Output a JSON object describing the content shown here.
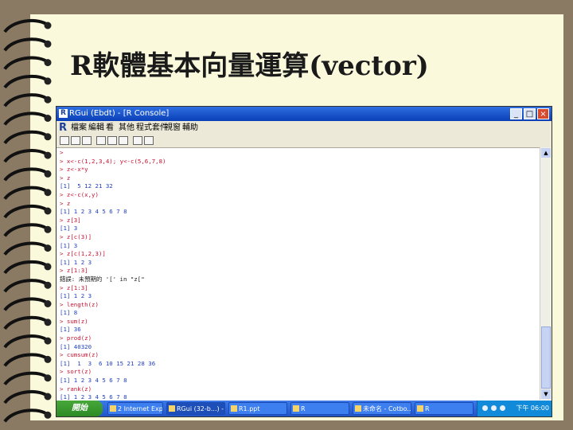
{
  "slide": {
    "title": "R軟體基本向量運算(vector)"
  },
  "window": {
    "title": "RGui (Ebdt) - [R Console]",
    "controls": {
      "minimize": "_",
      "maximize": "□",
      "close": "×"
    },
    "menu": [
      "檔案",
      "編輯",
      "看",
      "其他",
      "程式套件",
      "視窗",
      "輔助"
    ]
  },
  "console": {
    "lines": [
      {
        "kind": "in",
        "text": ">"
      },
      {
        "kind": "in",
        "text": "> x<-c(1,2,3,4); y<-c(5,6,7,8)"
      },
      {
        "kind": "in",
        "text": "> z<-x*y"
      },
      {
        "kind": "in",
        "text": "> z"
      },
      {
        "kind": "out",
        "text": "[1]  5 12 21 32"
      },
      {
        "kind": "in",
        "text": "> z<-c(x,y)"
      },
      {
        "kind": "in",
        "text": "> z"
      },
      {
        "kind": "out",
        "text": "[1] 1 2 3 4 5 6 7 8"
      },
      {
        "kind": "in",
        "text": "> z[3]"
      },
      {
        "kind": "out",
        "text": "[1] 3"
      },
      {
        "kind": "in",
        "text": "> z[c(3)]"
      },
      {
        "kind": "out",
        "text": "[1] 3"
      },
      {
        "kind": "in",
        "text": "> z[c(1,2,3)]"
      },
      {
        "kind": "out",
        "text": "[1] 1 2 3"
      },
      {
        "kind": "in",
        "text": "> z[1:3]"
      },
      {
        "kind": "err",
        "text": "錯誤: 未預期的 '[' in \"z[\""
      },
      {
        "kind": "in",
        "text": "> z[1:3]"
      },
      {
        "kind": "out",
        "text": "[1] 1 2 3"
      },
      {
        "kind": "in",
        "text": "> length(z)"
      },
      {
        "kind": "out",
        "text": "[1] 8"
      },
      {
        "kind": "in",
        "text": "> sum(z)"
      },
      {
        "kind": "out",
        "text": "[1] 36"
      },
      {
        "kind": "in",
        "text": "> prod(z)"
      },
      {
        "kind": "out",
        "text": "[1] 40320"
      },
      {
        "kind": "in",
        "text": "> cumsum(z)"
      },
      {
        "kind": "out",
        "text": "[1]  1  3  6 10 15 21 28 36"
      },
      {
        "kind": "in",
        "text": "> sort(z)"
      },
      {
        "kind": "out",
        "text": "[1] 1 2 3 4 5 6 7 8"
      },
      {
        "kind": "in",
        "text": "> rank(z)"
      },
      {
        "kind": "out",
        "text": "[1] 1 2 3 4 5 6 7 8"
      },
      {
        "kind": "in",
        "text": "> |"
      }
    ]
  },
  "taskbar": {
    "start_label": "開始",
    "tasks": [
      "2 Internet Exp...",
      "RGui (32-b...) - [...",
      "R1.ppt",
      "R",
      "未命名 - Cotbo...",
      "R"
    ],
    "clock": "下午 06:00"
  },
  "colors": {
    "slide_background": "#fbf9dc",
    "outer_background": "#8a7a64",
    "titlebar": "#0a3fb8",
    "input_text": "#c8102e",
    "output_text": "#1f3fbf"
  }
}
